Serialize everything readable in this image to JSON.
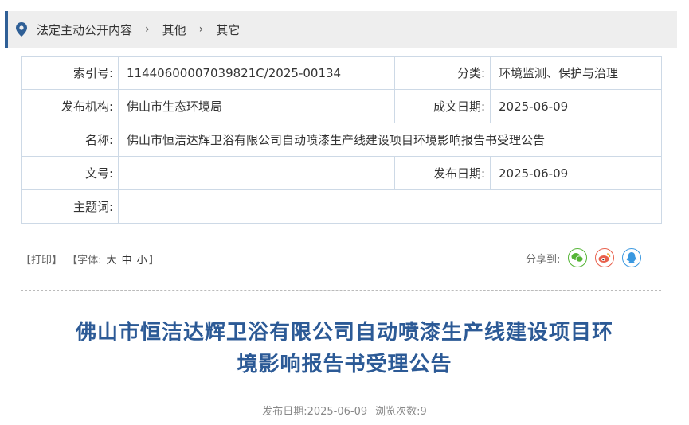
{
  "breadcrumb": {
    "items": [
      "法定主动公开内容",
      "其他",
      "其它"
    ],
    "separator": "›"
  },
  "meta": {
    "index_label": "索引号:",
    "index_value": "11440600007039821C/2025-00134",
    "category_label": "分类:",
    "category_value": "环境监测、保护与治理",
    "publisher_label": "发布机构:",
    "publisher_value": "佛山市生态环境局",
    "doc_date_label": "成文日期:",
    "doc_date_value": "2025-06-09",
    "name_label": "名称:",
    "name_value": "佛山市恒洁达辉卫浴有限公司自动喷漆生产线建设项目环境影响报告书受理公告",
    "doc_no_label": "文号:",
    "doc_no_value": "",
    "pub_date_label": "发布日期:",
    "pub_date_value": "2025-06-09",
    "keywords_label": "主题词:",
    "keywords_value": ""
  },
  "tools": {
    "print": "【打印】",
    "font_prefix": "【字体:",
    "font_large": "大",
    "font_medium": "中",
    "font_small": "小",
    "font_suffix": "】",
    "share_label": "分享到:"
  },
  "article": {
    "title_line1": "佛山市恒洁达辉卫浴有限公司自动喷漆生产线建设项目环",
    "title_line2": "境影响报告书受理公告",
    "pub_date_text": "发布日期:2025-06-09",
    "views_text": "浏览次数:9"
  },
  "colors": {
    "accent": "#2f5f96",
    "title": "#2c5a96",
    "wechat": "#54b435",
    "weibo": "#e8604c",
    "qq": "#3a98e0"
  },
  "icons": [
    "location-pin-icon",
    "wechat-icon",
    "weibo-icon",
    "qq-icon"
  ]
}
